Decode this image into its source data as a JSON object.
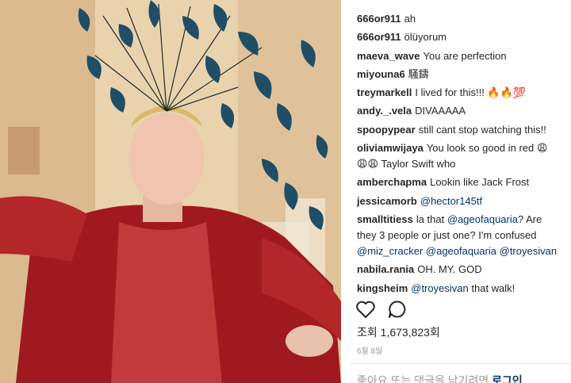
{
  "comments": [
    {
      "user": "666or911",
      "text": "ah"
    },
    {
      "user": "666or911",
      "text": "ölüyorum"
    },
    {
      "user": "maeva_wave",
      "text": "You are perfection"
    },
    {
      "user": "miyouna6",
      "text": "騷鑄"
    },
    {
      "user": "treymarkell",
      "text": "I lived for this!!! 🔥🔥💯"
    },
    {
      "user": "andy._.vela",
      "text": "DIVAAAAA"
    },
    {
      "user": "spoopypear",
      "text": "still cant stop watching this!!"
    },
    {
      "user": "oliviamwijaya",
      "text": "You look so good in red 😩",
      "text2": "😩😩 Taylor Swift who"
    },
    {
      "user": "amberchapma",
      "text": "Lookin like Jack Frost"
    },
    {
      "user": "jessicamorb",
      "mention": "@hector145tf"
    },
    {
      "user": "smalltitiess",
      "text_a": "la that",
      "mention_a": "@ageofaquaria",
      "text_b": "? Are they 3 people or just one? I'm confused",
      "mention_c": "@miz_cracker",
      "mention_d": "@ageofaquaria",
      "mention_e": "@troyesivan"
    },
    {
      "user": "nabila.rania",
      "text": "OH. MY. GOD"
    },
    {
      "user": "kingsheim",
      "mention": "@troyesivan",
      "text": "that walk!"
    }
  ],
  "actions": {
    "like": "heart-icon",
    "comment": "comment-icon"
  },
  "views": {
    "label": "조회",
    "count": "1,673,823회"
  },
  "date": "6월 8일",
  "footer": {
    "prompt": "좋아요 또는 댓글을 남기려면",
    "login": "로그인"
  }
}
